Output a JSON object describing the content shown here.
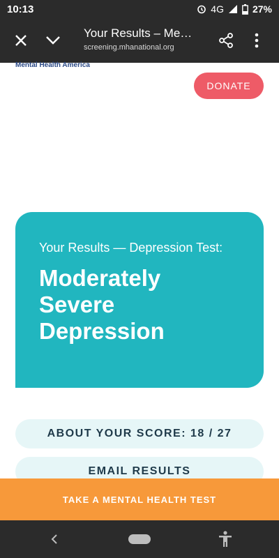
{
  "status_bar": {
    "time": "10:13",
    "network": "4G",
    "battery": "27%"
  },
  "browser": {
    "title": "Your Results – Me…",
    "url": "screening.mhanational.org",
    "icons": [
      "close-icon",
      "chevron-down-icon",
      "share-icon",
      "more-vert-icon"
    ]
  },
  "page": {
    "logo_text": "Mental Health America",
    "donate_label": "DONATE",
    "results": {
      "subtitle": "Your Results — Depression Test:",
      "result_text": "Moderately Severe Depression"
    },
    "score_label": "ABOUT YOUR SCORE: 18 / 27",
    "email_label": "EMAIL RESULTS",
    "cta_label": "TAKE A MENTAL HEALTH TEST"
  },
  "colors": {
    "card": "#21b6bf",
    "donate": "#ee5b67",
    "cta": "#f7993a",
    "pill": "#e6f6f7"
  }
}
